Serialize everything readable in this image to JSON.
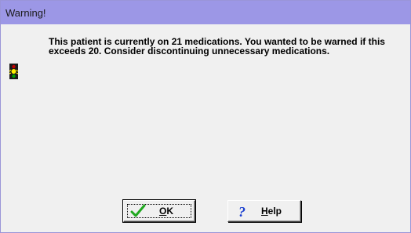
{
  "window": {
    "title": "Warning!"
  },
  "message": {
    "text": "This patient is currently on 21 medications. You wanted to be warned if this exceeds 20. Consider discontinuing unnecessary medications.",
    "icon": "traffic-light-warning-icon"
  },
  "buttons": {
    "ok": {
      "mnemonic": "O",
      "rest": "K",
      "icon": "checkmark-icon"
    },
    "help": {
      "mnemonic": "H",
      "rest": "elp",
      "icon": "question-mark-icon"
    }
  },
  "colors": {
    "titlebar": "#9c97e6",
    "dialog_bg": "#f0f0f0",
    "check_green": "#1fa81f",
    "question_blue": "#1a3fd0"
  }
}
